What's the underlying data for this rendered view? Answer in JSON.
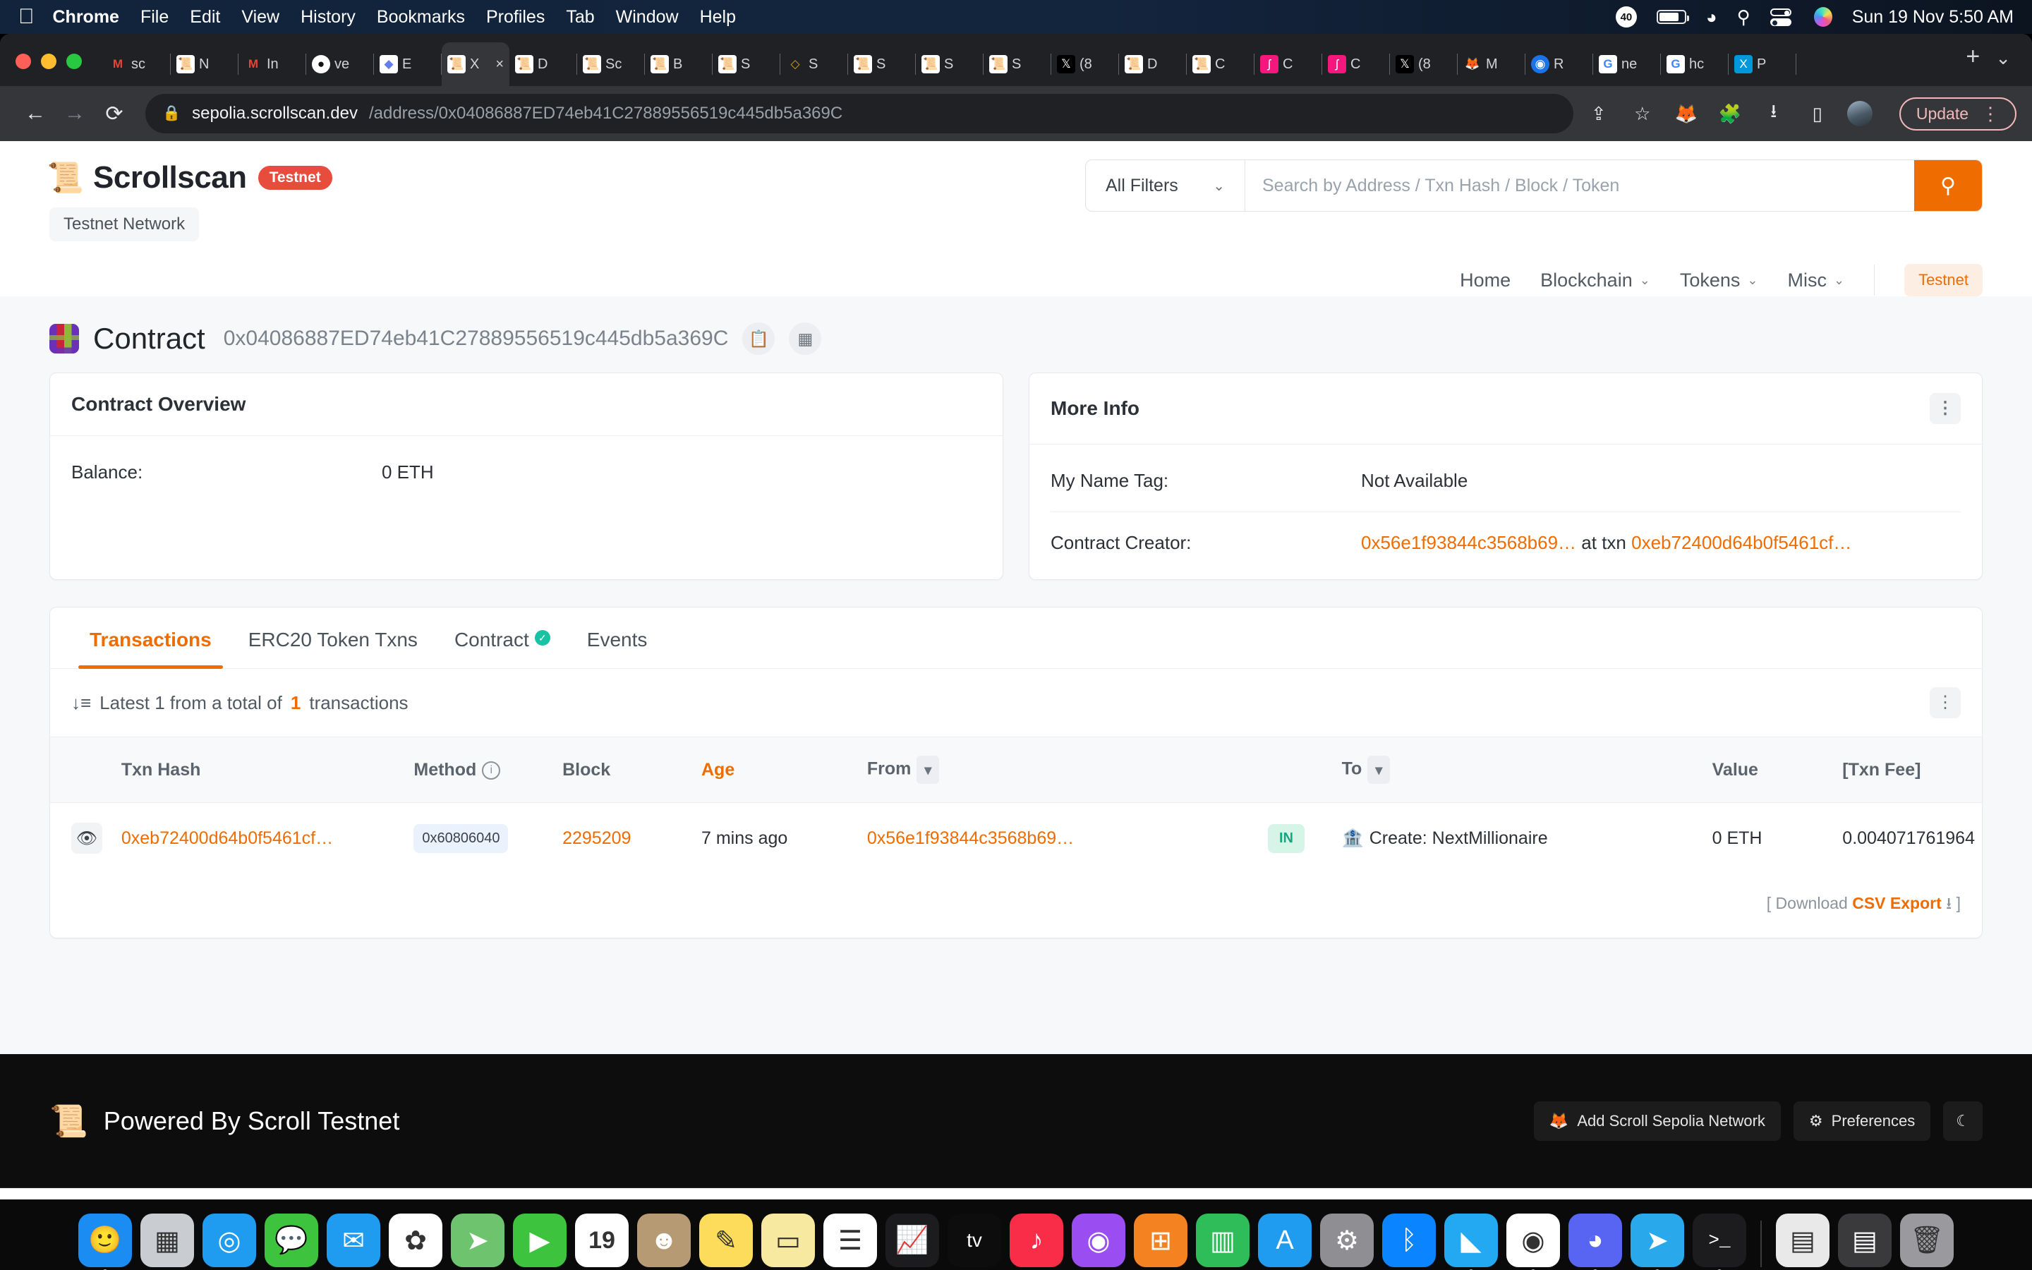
{
  "macbar": {
    "apple_icon": "apple-icon",
    "items": [
      "Chrome",
      "File",
      "Edit",
      "View",
      "History",
      "Bookmarks",
      "Profiles",
      "Tab",
      "Window",
      "Help"
    ],
    "badge_count": "40",
    "clock": "Sun 19 Nov  5:50 AM",
    "status_icons": [
      "battery-icon",
      "wifi-icon",
      "spotlight-search-icon",
      "control-center-icon",
      "siri-icon"
    ]
  },
  "browser": {
    "tabs": [
      {
        "label": "sc",
        "favicon": "gmail-icon",
        "active": false
      },
      {
        "label": "N",
        "favicon": "scrollscan-icon",
        "active": false
      },
      {
        "label": "In",
        "favicon": "gmail-icon",
        "active": false
      },
      {
        "label": "ve",
        "favicon": "github-icon",
        "active": false
      },
      {
        "label": "E",
        "favicon": "ethereum-icon",
        "active": false
      },
      {
        "label": "X",
        "favicon": "scrollscan-icon",
        "active": true
      },
      {
        "label": "D",
        "favicon": "scrollscan-icon",
        "active": false
      },
      {
        "label": "Sc",
        "favicon": "scrollscan-icon",
        "active": false
      },
      {
        "label": "B",
        "favicon": "scrollscan-icon",
        "active": false
      },
      {
        "label": "S",
        "favicon": "scrollscan-icon",
        "active": false
      },
      {
        "label": "S",
        "favicon": "diamond-icon",
        "active": false
      },
      {
        "label": "S",
        "favicon": "scrollscan-icon",
        "active": false
      },
      {
        "label": "S",
        "favicon": "scrollscan-icon",
        "active": false
      },
      {
        "label": "S",
        "favicon": "scrollscan-icon",
        "active": false
      },
      {
        "label": "(8",
        "favicon": "x-twitter-icon",
        "active": false
      },
      {
        "label": "D",
        "favicon": "scrollscan-icon",
        "active": false
      },
      {
        "label": "C",
        "favicon": "scrollscan-icon",
        "active": false
      },
      {
        "label": "C",
        "favicon": "pink-icon",
        "active": false
      },
      {
        "label": "C",
        "favicon": "pink-icon",
        "active": false
      },
      {
        "label": "(8",
        "favicon": "x-twitter-icon",
        "active": false
      },
      {
        "label": "M",
        "favicon": "metamask-icon",
        "active": false
      },
      {
        "label": "R",
        "favicon": "blue-globe-icon",
        "active": false
      },
      {
        "label": "ne",
        "favicon": "google-icon",
        "active": false
      },
      {
        "label": "hc",
        "favicon": "google-icon",
        "active": false
      },
      {
        "label": "P",
        "favicon": "teal-x-icon",
        "active": false
      }
    ],
    "new_tab_label": "+",
    "tab_list_chevron": "chevron-down-icon",
    "toolbar": {
      "back_icon": "back-arrow-icon",
      "forward_icon": "forward-arrow-icon",
      "reload_icon": "reload-icon",
      "lock_icon": "lock-icon",
      "url_host": "sepolia.scrollscan.dev",
      "url_path": "/address/0x04086887ED74eb41C27889556519c445db5a369C",
      "share_icon": "share-icon",
      "bookmark_icon": "star-icon",
      "metamask_icon": "metamask-icon",
      "extensions_icon": "puzzle-piece-icon",
      "downloads_icon": "download-icon",
      "sidepanel_icon": "side-panel-icon",
      "profile_icon": "avatar",
      "update_label": "Update",
      "menu_icon": "three-dot-menu-icon"
    }
  },
  "site": {
    "brand": "Scrollscan",
    "brand_badge": "Testnet",
    "network_button": "Testnet Network",
    "search": {
      "filter_label": "All Filters",
      "placeholder": "Search by Address / Txn Hash / Block / Token",
      "value": "",
      "button_icon": "search-icon"
    },
    "nav": [
      {
        "label": "Home",
        "has_chevron": false
      },
      {
        "label": "Blockchain",
        "has_chevron": true
      },
      {
        "label": "Tokens",
        "has_chevron": true
      },
      {
        "label": "Misc",
        "has_chevron": true
      }
    ],
    "network_tag": "Testnet"
  },
  "page_title": {
    "label": "Contract",
    "address": "0x04086887ED74eb41C27889556519c445db5a369C",
    "copy_icon": "copy-icon",
    "qr_icon": "qr-code-icon"
  },
  "contract_overview": {
    "heading": "Contract Overview",
    "rows": [
      {
        "key": "Balance:",
        "value": "0 ETH"
      }
    ]
  },
  "more_info": {
    "heading": "More Info",
    "menu_icon": "three-dot-menu-icon",
    "name_tag_key": "My Name Tag:",
    "name_tag_value": "Not Available",
    "creator_key": "Contract Creator:",
    "creator_address": "0x56e1f93844c3568b69…",
    "creator_at": "at txn",
    "creator_txn": "0xeb72400d64b0f5461cf…"
  },
  "tx_panel": {
    "tabs": [
      {
        "label": "Transactions",
        "active": true,
        "verified": false
      },
      {
        "label": "ERC20 Token Txns",
        "active": false,
        "verified": false
      },
      {
        "label": "Contract",
        "active": false,
        "verified": true
      },
      {
        "label": "Events",
        "active": false,
        "verified": false
      }
    ],
    "summary_prefix": "Latest 1 from a total of",
    "summary_count": "1",
    "summary_suffix": "transactions",
    "sort_icon": "sort-descending-icon",
    "menu_icon": "three-dot-menu-icon",
    "columns": [
      "Txn Hash",
      "Method",
      "Block",
      "Age",
      "From",
      "",
      "To",
      "Value",
      "[Txn Fee]"
    ],
    "rows": [
      {
        "eye_icon": "eye-icon",
        "txn_hash": "0xeb72400d64b0f5461cf…",
        "method": "0x60806040",
        "block": "2295209",
        "age": "7 mins ago",
        "from": "0x56e1f93844c3568b69…",
        "direction": "IN",
        "to_icon": "contract-icon",
        "to": "Create: NextMillionaire",
        "value": "0 ETH",
        "fee": "0.004071761964"
      }
    ],
    "csv_prefix": "[ Download",
    "csv_label": "CSV Export",
    "csv_icon": "download-icon",
    "csv_suffix": "]"
  },
  "site_footer": {
    "logo_icon": "scrollscan-icon",
    "text": "Powered By Scroll Testnet",
    "add_network_label": "Add Scroll Sepolia Network",
    "add_network_icon": "metamask-icon",
    "preferences_label": "Preferences",
    "preferences_icon": "sliders-icon",
    "theme_icon": "moon-icon"
  },
  "dock": {
    "items": [
      {
        "name": "finder",
        "glyph": "🙂",
        "color": "#1b8cf2",
        "running": true
      },
      {
        "name": "launchpad",
        "glyph": "▦",
        "color": "#c9ccd1",
        "running": false
      },
      {
        "name": "safari",
        "glyph": "◎",
        "color": "#1f9cf0",
        "running": false
      },
      {
        "name": "messages",
        "glyph": "💬",
        "color": "#3ec33e",
        "running": false
      },
      {
        "name": "mail",
        "glyph": "✉",
        "color": "#1f9cf0",
        "running": false
      },
      {
        "name": "photos",
        "glyph": "✿",
        "color": "#ffffff",
        "running": false
      },
      {
        "name": "maps",
        "glyph": "➤",
        "color": "#6ec46e",
        "running": false
      },
      {
        "name": "facetime",
        "glyph": "▶",
        "color": "#3ec33e",
        "running": false
      },
      {
        "name": "calendar",
        "glyph": "19",
        "color": "#ffffff",
        "running": false
      },
      {
        "name": "contacts",
        "glyph": "☻",
        "color": "#b59a74",
        "running": false
      },
      {
        "name": "notes",
        "glyph": "✎",
        "color": "#fddc5c",
        "running": false
      },
      {
        "name": "stickies",
        "glyph": "▭",
        "color": "#f7e9a0",
        "running": false
      },
      {
        "name": "reminders",
        "glyph": "☰",
        "color": "#ffffff",
        "running": false
      },
      {
        "name": "stocks",
        "glyph": "📈",
        "color": "#1c1c1e",
        "running": false
      },
      {
        "name": "apple-tv",
        "glyph": "tv",
        "color": "#0d0d0d",
        "running": false
      },
      {
        "name": "music",
        "glyph": "♪",
        "color": "#fa2d48",
        "running": false
      },
      {
        "name": "podcasts",
        "glyph": "◉",
        "color": "#9a4df0",
        "running": false
      },
      {
        "name": "app-store-books",
        "glyph": "⊞",
        "color": "#f58220",
        "running": false
      },
      {
        "name": "numbers",
        "glyph": "▥",
        "color": "#2ebd59",
        "running": false
      },
      {
        "name": "app-store",
        "glyph": "A",
        "color": "#1f9cf0",
        "running": false
      },
      {
        "name": "system-settings",
        "glyph": "⚙",
        "color": "#8e8e93",
        "running": false
      },
      {
        "name": "bluetooth",
        "glyph": "ᛒ",
        "color": "#0a84ff",
        "running": false
      },
      {
        "name": "vs-code",
        "glyph": "◣",
        "color": "#23a9f2",
        "running": true
      },
      {
        "name": "chrome",
        "glyph": "◉",
        "color": "#ffffff",
        "running": true
      },
      {
        "name": "discord",
        "glyph": "◕",
        "color": "#5865f2",
        "running": true
      },
      {
        "name": "telegram",
        "glyph": "➤",
        "color": "#29a9eb",
        "running": true
      },
      {
        "name": "terminal",
        "glyph": ">_",
        "color": "#1c1c1e",
        "running": true
      },
      {
        "name": "document",
        "glyph": "▤",
        "color": "#e9e9ea",
        "running": false
      },
      {
        "name": "downloads",
        "glyph": "▤",
        "color": "#3a3a3c",
        "running": false
      },
      {
        "name": "trash",
        "glyph": "🗑",
        "color": "#9a9a9e",
        "running": false
      }
    ]
  }
}
